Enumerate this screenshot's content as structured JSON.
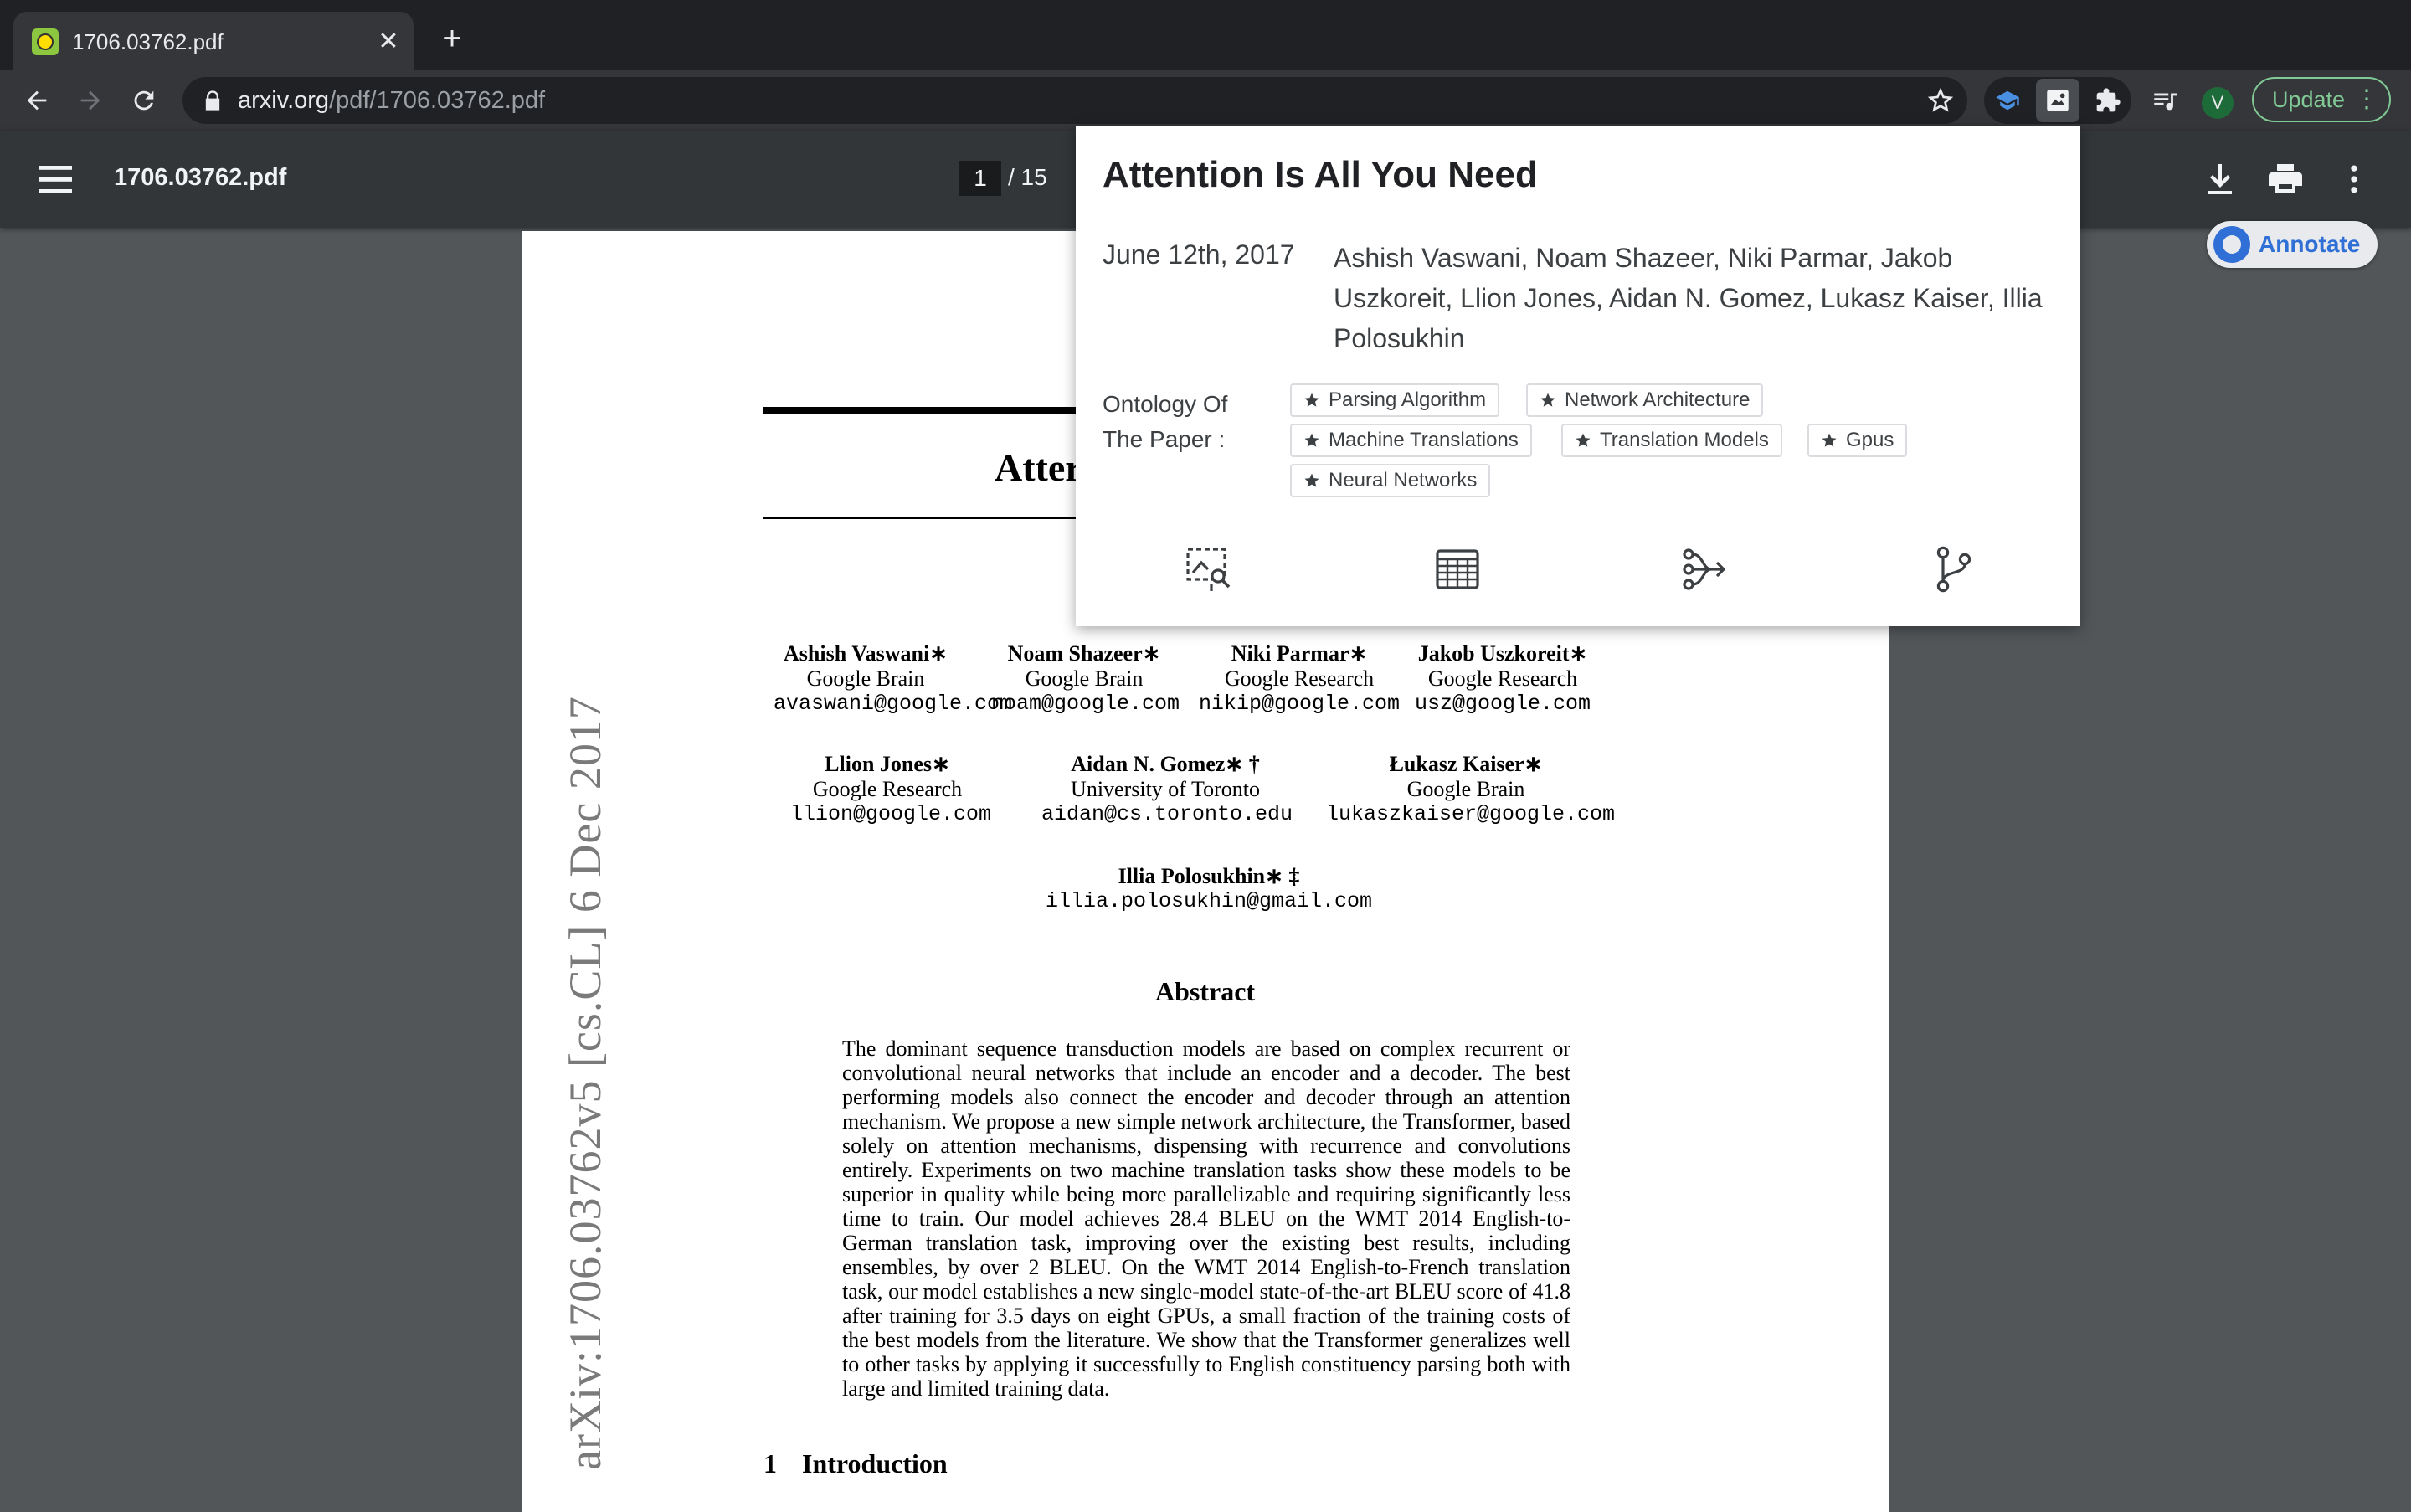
{
  "browser": {
    "tab_title": "1706.03762.pdf",
    "tab_close": "✕",
    "new_tab": "+",
    "url_host": "arxiv.org",
    "url_path": "/pdf/1706.03762.pdf",
    "update_label": "Update",
    "avatar_initial": "V"
  },
  "pdf_viewer": {
    "title": "1706.03762.pdf",
    "current_page": "1",
    "total_pages": "/ 15"
  },
  "paper": {
    "title_fragment": "Atter",
    "authors": [
      {
        "name": "Ashish Vaswani∗",
        "affiliation": "Google Brain",
        "email": "avaswani@google.com"
      },
      {
        "name": "Noam Shazeer∗",
        "affiliation": "Google Brain",
        "email": "noam@google.com"
      },
      {
        "name": "Niki Parmar∗",
        "affiliation": "Google Research",
        "email": "nikip@google.com"
      },
      {
        "name": "Jakob Uszkoreit∗",
        "affiliation": "Google Research",
        "email": "usz@google.com"
      },
      {
        "name": "Llion Jones∗",
        "affiliation": "Google Research",
        "email": "llion@google.com"
      },
      {
        "name": "Aidan N. Gomez∗ †",
        "affiliation": "University of Toronto",
        "email": "aidan@cs.toronto.edu"
      },
      {
        "name": "Łukasz Kaiser∗",
        "affiliation": "Google Brain",
        "email": "lukaszkaiser@google.com"
      },
      {
        "name": "Illia Polosukhin∗ ‡",
        "affiliation": "",
        "email": "illia.polosukhin@gmail.com"
      }
    ],
    "arxiv_stamp": "arXiv:1706.03762v5  [cs.CL]  6 Dec 2017",
    "abstract_heading": "Abstract",
    "abstract_text": "The dominant sequence transduction models are based on complex recurrent or convolutional neural networks that include an encoder and a decoder. The best performing models also connect the encoder and decoder through an attention mechanism. We propose a new simple network architecture, the Transformer, based solely on attention mechanisms, dispensing with recurrence and convolutions entirely. Experiments on two machine translation tasks show these models to be superior in quality while being more parallelizable and requiring significantly less time to train. Our model achieves 28.4 BLEU on the WMT 2014 English-to-German translation task, improving over the existing best results, including ensembles, by over 2 BLEU. On the WMT 2014 English-to-French translation task, our model establishes a new single-model state-of-the-art BLEU score of 41.8 after training for 3.5 days on eight GPUs, a small fraction of the training costs of the best models from the literature. We show that the Transformer generalizes well to other tasks by applying it successfully to English constituency parsing both with large and limited training data.",
    "intro_number": "1",
    "intro_heading": "Introduction"
  },
  "popup": {
    "title": "Attention Is All You Need",
    "date": "June 12th, 2017",
    "authors": "Ashish Vaswani, Noam Shazeer, Niki Parmar, Jakob Uszkoreit, Llion Jones, Aidan N. Gomez, Lukasz Kaiser, Illia Polosukhin",
    "ontology_label": "Ontology Of The Paper :",
    "tags": [
      "Parsing Algorithm",
      "Network Architecture",
      "Machine Translations",
      "Translation Models",
      "Gpus",
      "Neural Networks"
    ],
    "actions": [
      "figure-search-icon",
      "table-icon",
      "flow-icon",
      "branch-icon"
    ]
  },
  "annotate": {
    "label": "Annotate"
  },
  "colors": {
    "tabstrip": "#202124",
    "toolbar": "#35363a",
    "pdf_bar": "#323639",
    "viewer_bg": "#525659",
    "update_accent": "#81c995",
    "annotate_accent": "#2f6fd6"
  }
}
